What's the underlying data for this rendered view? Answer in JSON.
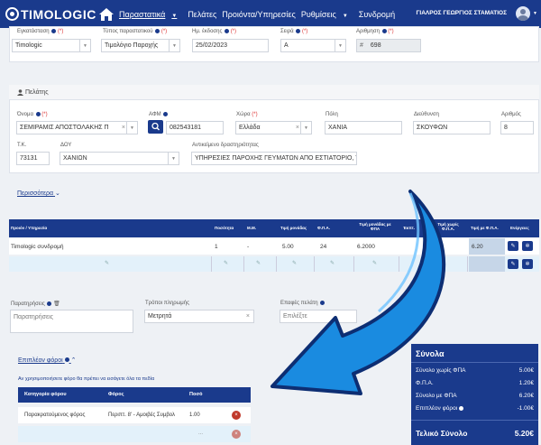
{
  "nav": {
    "logo": "TIMOLOGIC",
    "menu": [
      "Παραστατικά",
      "Πελάτες",
      "Προιόντα/Υπηρεσίες",
      "Ρυθμίσεις",
      "Συνδρομή"
    ],
    "user": "ΓΙΑΛΡΟΣ ΓΕΩΡΓΙΟΣ ΣΤΑΜΑΤΙΟΣ"
  },
  "doc": {
    "install_label": "Εγκατάσταση",
    "install_value": "Timologic",
    "type_label": "Τύπος παραστατικού",
    "type_value": "Τιμολόγιο Παροχής",
    "date_label": "Ημ. έκδοσης",
    "date_value": "25/02/2023",
    "series_label": "Σειρά",
    "series_value": "Α",
    "number_label": "Αριθμηση",
    "number_prefix": "#",
    "number_value": "698"
  },
  "customer": {
    "title": "Πελάτης",
    "name_label": "Όνομα",
    "name_value": "ΣΕΜΙΡΑΜΙΣ ΑΠΟΣΤΟΛΑΚΗΣ Π",
    "afm_label": "ΑΦΜ",
    "afm_value": "082543181",
    "country_label": "Χώρα",
    "country_value": "Ελλάδα",
    "city_label": "Πόλη",
    "city_value": "ΧΑΝΙΑ",
    "address_label": "Διεύθυνση",
    "address_value": "ΣΚΟΥΦΩΝ",
    "num_label": "Αριθμός",
    "num_value": "8",
    "tk_label": "Τ.Κ.",
    "tk_value": "73131",
    "doy_label": "ΔΟΥ",
    "doy_value": "ΧΑΝΙΩΝ",
    "activity_label": "Αντικείμενο δραστηριότητας",
    "activity_value": "ΥΠΗΡΕΣΙΕΣ ΠΑΡΟΧΗΣ ΓΕΥΜΑΤΩΝ ΑΠΟ ΕΣΤΙΑΤΟΡΙΟ, Τ",
    "more": "Περισσότερα"
  },
  "items": {
    "headers": [
      "Προιόν / Υπηρεσία",
      "Ποσότητα",
      "Μ.Μ.",
      "Τιμή μονάδας",
      "Φ.Π.Α.",
      "Τιμή μονάδας με ΦΠΑ",
      "Έκπτ.",
      "Τιμή χωρίς Φ.Π.Α.",
      "Τιμή με Φ.Π.Α.",
      "Ενέργειες"
    ],
    "row": [
      "Timologic συνδρομή",
      "1",
      "-",
      "5.00",
      "24",
      "6.2000",
      "",
      "5.00",
      "6.20"
    ]
  },
  "footer": {
    "notes_label": "Παρατηρήσεις",
    "notes_placeholder": "Παρατηρήσεις",
    "payment_label": "Τρόποι πληρωμής",
    "payment_value": "Μετρητά",
    "contact_label": "Επαφές πελάτη",
    "contact_placeholder": "Επιλέξτε"
  },
  "taxes": {
    "title": "Επιπλέον φόροι",
    "note": "Αν χρησιμοποιήσετε φόρο θα πρέπει να εισάγετε όλα τα πεδία",
    "headers": [
      "Κατηγορία φόρου",
      "Φόρος",
      "Ποσό"
    ],
    "row": [
      "Παρακρατούμενος φόρος",
      "Περιπτ. 8' - Αμοιβές Συμβολ",
      "1.00"
    ],
    "row2_placeholder": "..."
  },
  "totals": {
    "title": "Σύνολα",
    "net_label": "Σύνολο χωρίς ΦΠΑ",
    "net_value": "5.00€",
    "vat_label": "Φ.Π.Α.",
    "vat_value": "1.20€",
    "gross_label": "Σύνολο με ΦΠΑ",
    "gross_value": "6.20€",
    "extra_label": "Επιπλέον φόροι",
    "extra_value": "-1.00€",
    "final_label": "Τελικό Σύνολο",
    "final_value": "5.20€"
  },
  "colors": {
    "primary": "#1a3a8c",
    "arrow": "#1a8be0",
    "danger": "#c0392b"
  }
}
